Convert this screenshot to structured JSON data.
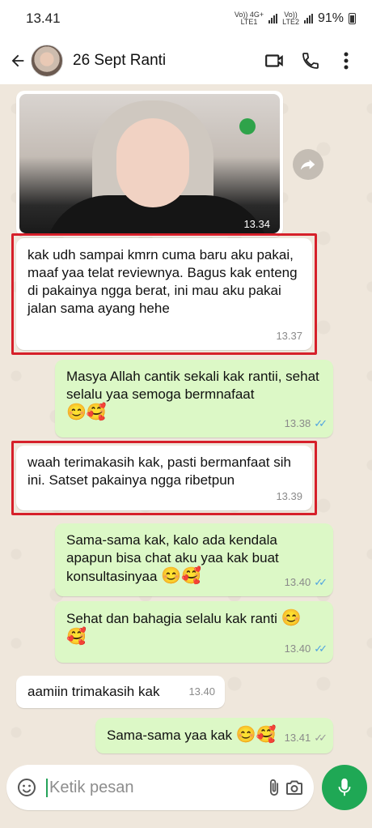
{
  "status": {
    "time": "13.41",
    "sim1": "Vo)) 4G+\nLTE1",
    "sim2": "Vo))\nLTE2",
    "battery": "91%"
  },
  "header": {
    "contact": "26 Sept Ranti"
  },
  "photo": {
    "time": "13.34"
  },
  "messages": [
    {
      "dir": "in",
      "text": "kak udh sampai kmrn cuma baru aku pakai, maaf yaa telat reviewnya. Bagus kak enteng di pakainya ngga berat, ini mau aku pakai jalan sama ayang hehe",
      "time": "13.37"
    },
    {
      "dir": "out",
      "text": "Masya Allah cantik sekali kak rantii, sehat selalu yaa semoga bermnafaat",
      "emoji": "😊🥰",
      "time": "13.38",
      "status": "read"
    },
    {
      "dir": "in",
      "text": "waah terimakasih kak, pasti bermanfaat sih ini. Satset pakainya ngga ribetpun",
      "time": "13.39"
    },
    {
      "dir": "out",
      "text": "Sama-sama kak, kalo ada kendala apapun bisa chat aku yaa kak buat konsultasinyaa",
      "emoji": "😊🥰",
      "time": "13.40",
      "status": "read"
    },
    {
      "dir": "out",
      "text": "Sehat dan bahagia selalu kak ranti",
      "emoji": "😊",
      "emoji2": "🥰",
      "time": "13.40",
      "status": "read"
    },
    {
      "dir": "in",
      "text": "aamiin trimakasih kak",
      "time": "13.40"
    },
    {
      "dir": "out",
      "text": "Sama-sama yaa kak",
      "emoji": "😊🥰",
      "time": "13.41",
      "status": "delivered"
    }
  ],
  "composer": {
    "placeholder": "Ketik pesan"
  },
  "ticks": "✓✓"
}
